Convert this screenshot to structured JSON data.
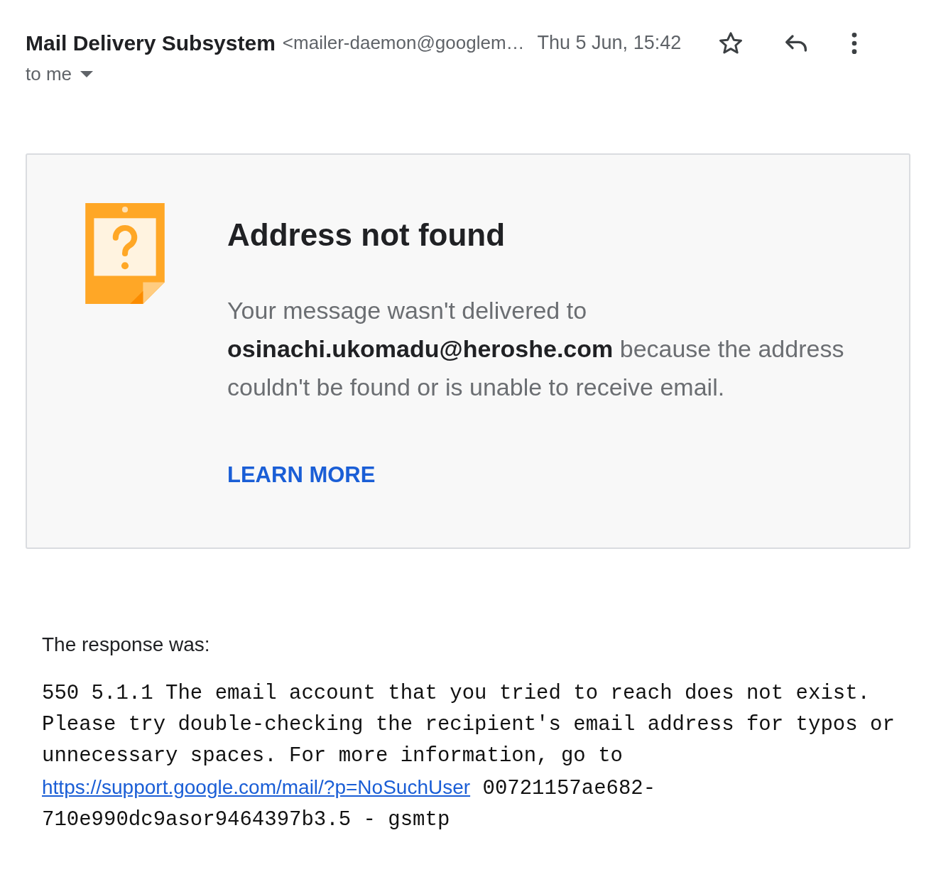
{
  "header": {
    "sender_name": "Mail Delivery Subsystem",
    "sender_address": "<mailer-daemon@googlem…",
    "date": "Thu 5 Jun, 15:42",
    "recipient": "to me"
  },
  "card": {
    "title": "Address not found",
    "message": "Your message wasn't delivered to **osinachi.ukomadu@heroshe.com** because the address couldn't be found or is unable to receive email.",
    "link": "LEARN MORE"
  },
  "response": {
    "label": "The response was:",
    "text_before": "550 5.1.1 The email account that you tried to reach does not exist. Please try double-checking the recipient's email address for typos or unnecessary spaces. For more information, go to",
    "link": "https://support.google.com/mail/?p=NoSuchUser",
    "text_after": "00721157ae682-710e990dc9asor9464397b3.5 - gsmtp"
  }
}
